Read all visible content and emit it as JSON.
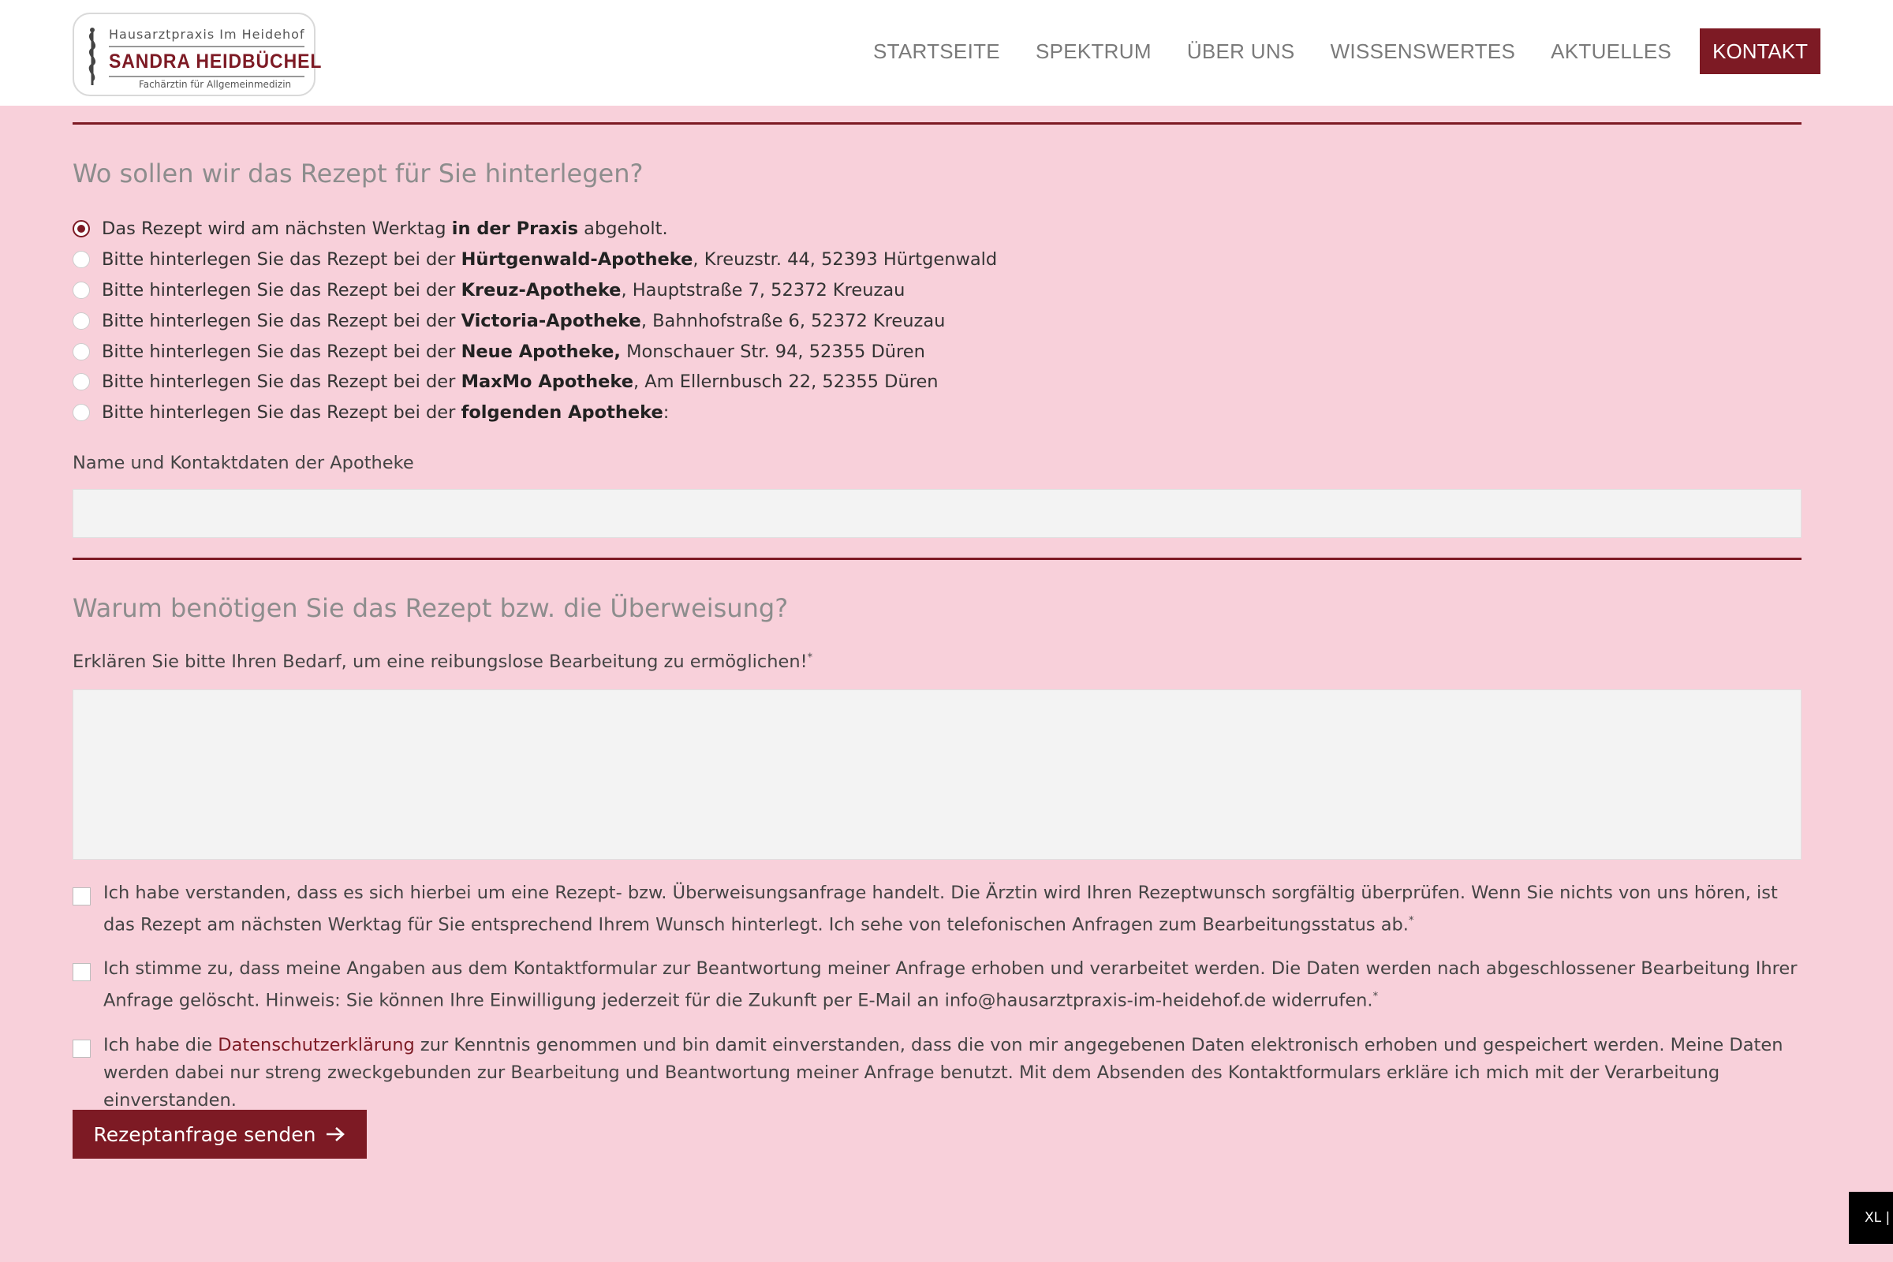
{
  "header": {
    "logo": {
      "top_line": "Hausarztpraxis Im Heidehof",
      "name": "SANDRA HEIDBÜCHEL",
      "subtitle": "Fachärztin für Allgemeinmedizin"
    },
    "nav": [
      "STARTSEITE",
      "SPEKTRUM",
      "ÜBER UNS",
      "WISSENSWERTES",
      "AKTUELLES"
    ],
    "cta": "KONTAKT"
  },
  "section_pickup": {
    "heading": "Wo sollen wir das Rezept für Sie hinterlegen?",
    "options": [
      {
        "pre": "Das Rezept wird am nächsten Werktag ",
        "bold": "in der Praxis",
        "post": " abgeholt.",
        "selected": true
      },
      {
        "pre": "Bitte hinterlegen Sie das Rezept bei der ",
        "bold": "Hürtgenwald-Apotheke",
        "post": ", Kreuzstr. 44, 52393 Hürtgenwald",
        "selected": false
      },
      {
        "pre": "Bitte hinterlegen Sie das Rezept bei der ",
        "bold": "Kreuz-Apotheke",
        "post": ", Hauptstraße 7, 52372 Kreuzau",
        "selected": false
      },
      {
        "pre": "Bitte hinterlegen Sie das Rezept bei der ",
        "bold": "Victoria-Apotheke",
        "post": ", Bahnhofstraße 6, 52372 Kreuzau",
        "selected": false
      },
      {
        "pre": "Bitte hinterlegen Sie das Rezept bei der ",
        "bold": "Neue Apotheke,",
        "post": " Monschauer Str. 94, 52355 Düren",
        "selected": false
      },
      {
        "pre": "Bitte hinterlegen Sie das Rezept bei der ",
        "bold": "MaxMo Apotheke",
        "post": ", Am Ellernbusch 22, 52355 Düren",
        "selected": false
      },
      {
        "pre": "Bitte hinterlegen Sie das Rezept bei der ",
        "bold": "folgenden Apotheke",
        "post": ":",
        "selected": false
      }
    ],
    "pharmacy_field_label": "Name und Kontaktdaten der Apotheke",
    "pharmacy_field_value": ""
  },
  "section_reason": {
    "heading": "Warum benötigen Sie das Rezept bzw. die Überweisung?",
    "field_label": "Erklären Sie bitte Ihren Bedarf, um eine reibungslose Bearbeitung zu ermöglichen!",
    "required_mark": "*",
    "field_value": ""
  },
  "consents": [
    {
      "text": "Ich habe verstanden, dass es sich hierbei um eine Rezept- bzw. Überweisungsanfrage handelt. Die Ärztin wird Ihren Rezeptwunsch sorgfältig überprüfen. Wenn Sie nichts von uns hören, ist das Rezept am nächsten Werktag für Sie entsprechend Ihrem Wunsch hinterlegt. Ich sehe von telefonischen Anfragen zum Bearbeitungsstatus ab.",
      "required_mark": "*",
      "checked": false
    },
    {
      "text": "Ich stimme zu, dass meine Angaben aus dem Kontaktformular zur Beantwortung meiner Anfrage erhoben und verarbeitet werden. Die Daten werden nach abgeschlossener Bearbeitung Ihrer Anfrage gelöscht. Hinweis: Sie können Ihre Einwilligung jederzeit für die Zukunft per E-Mail an info@hausarztpraxis-im-heidehof.de widerrufen.",
      "required_mark": "*",
      "checked": false
    },
    {
      "pre": "Ich habe die ",
      "link": "Datenschutzerklärung",
      "post": " zur Kenntnis genommen und bin damit einverstanden, dass die von mir angegebenen Daten elektronisch erhoben und gespeichert werden. Meine Daten werden dabei nur streng zweckgebunden zur Bearbeitung und Beantwortung meiner Anfrage benutzt. Mit dem Absenden des Kontaktformulars erkläre ich mich mit der Verarbeitung einverstanden.",
      "checked": false
    }
  ],
  "submit_label": "Rezeptanfrage senden",
  "breakpoint_badge": "XL |",
  "colors": {
    "accent": "#7d1a24",
    "background": "#f8d0da",
    "heading": "#8d8d8d"
  }
}
